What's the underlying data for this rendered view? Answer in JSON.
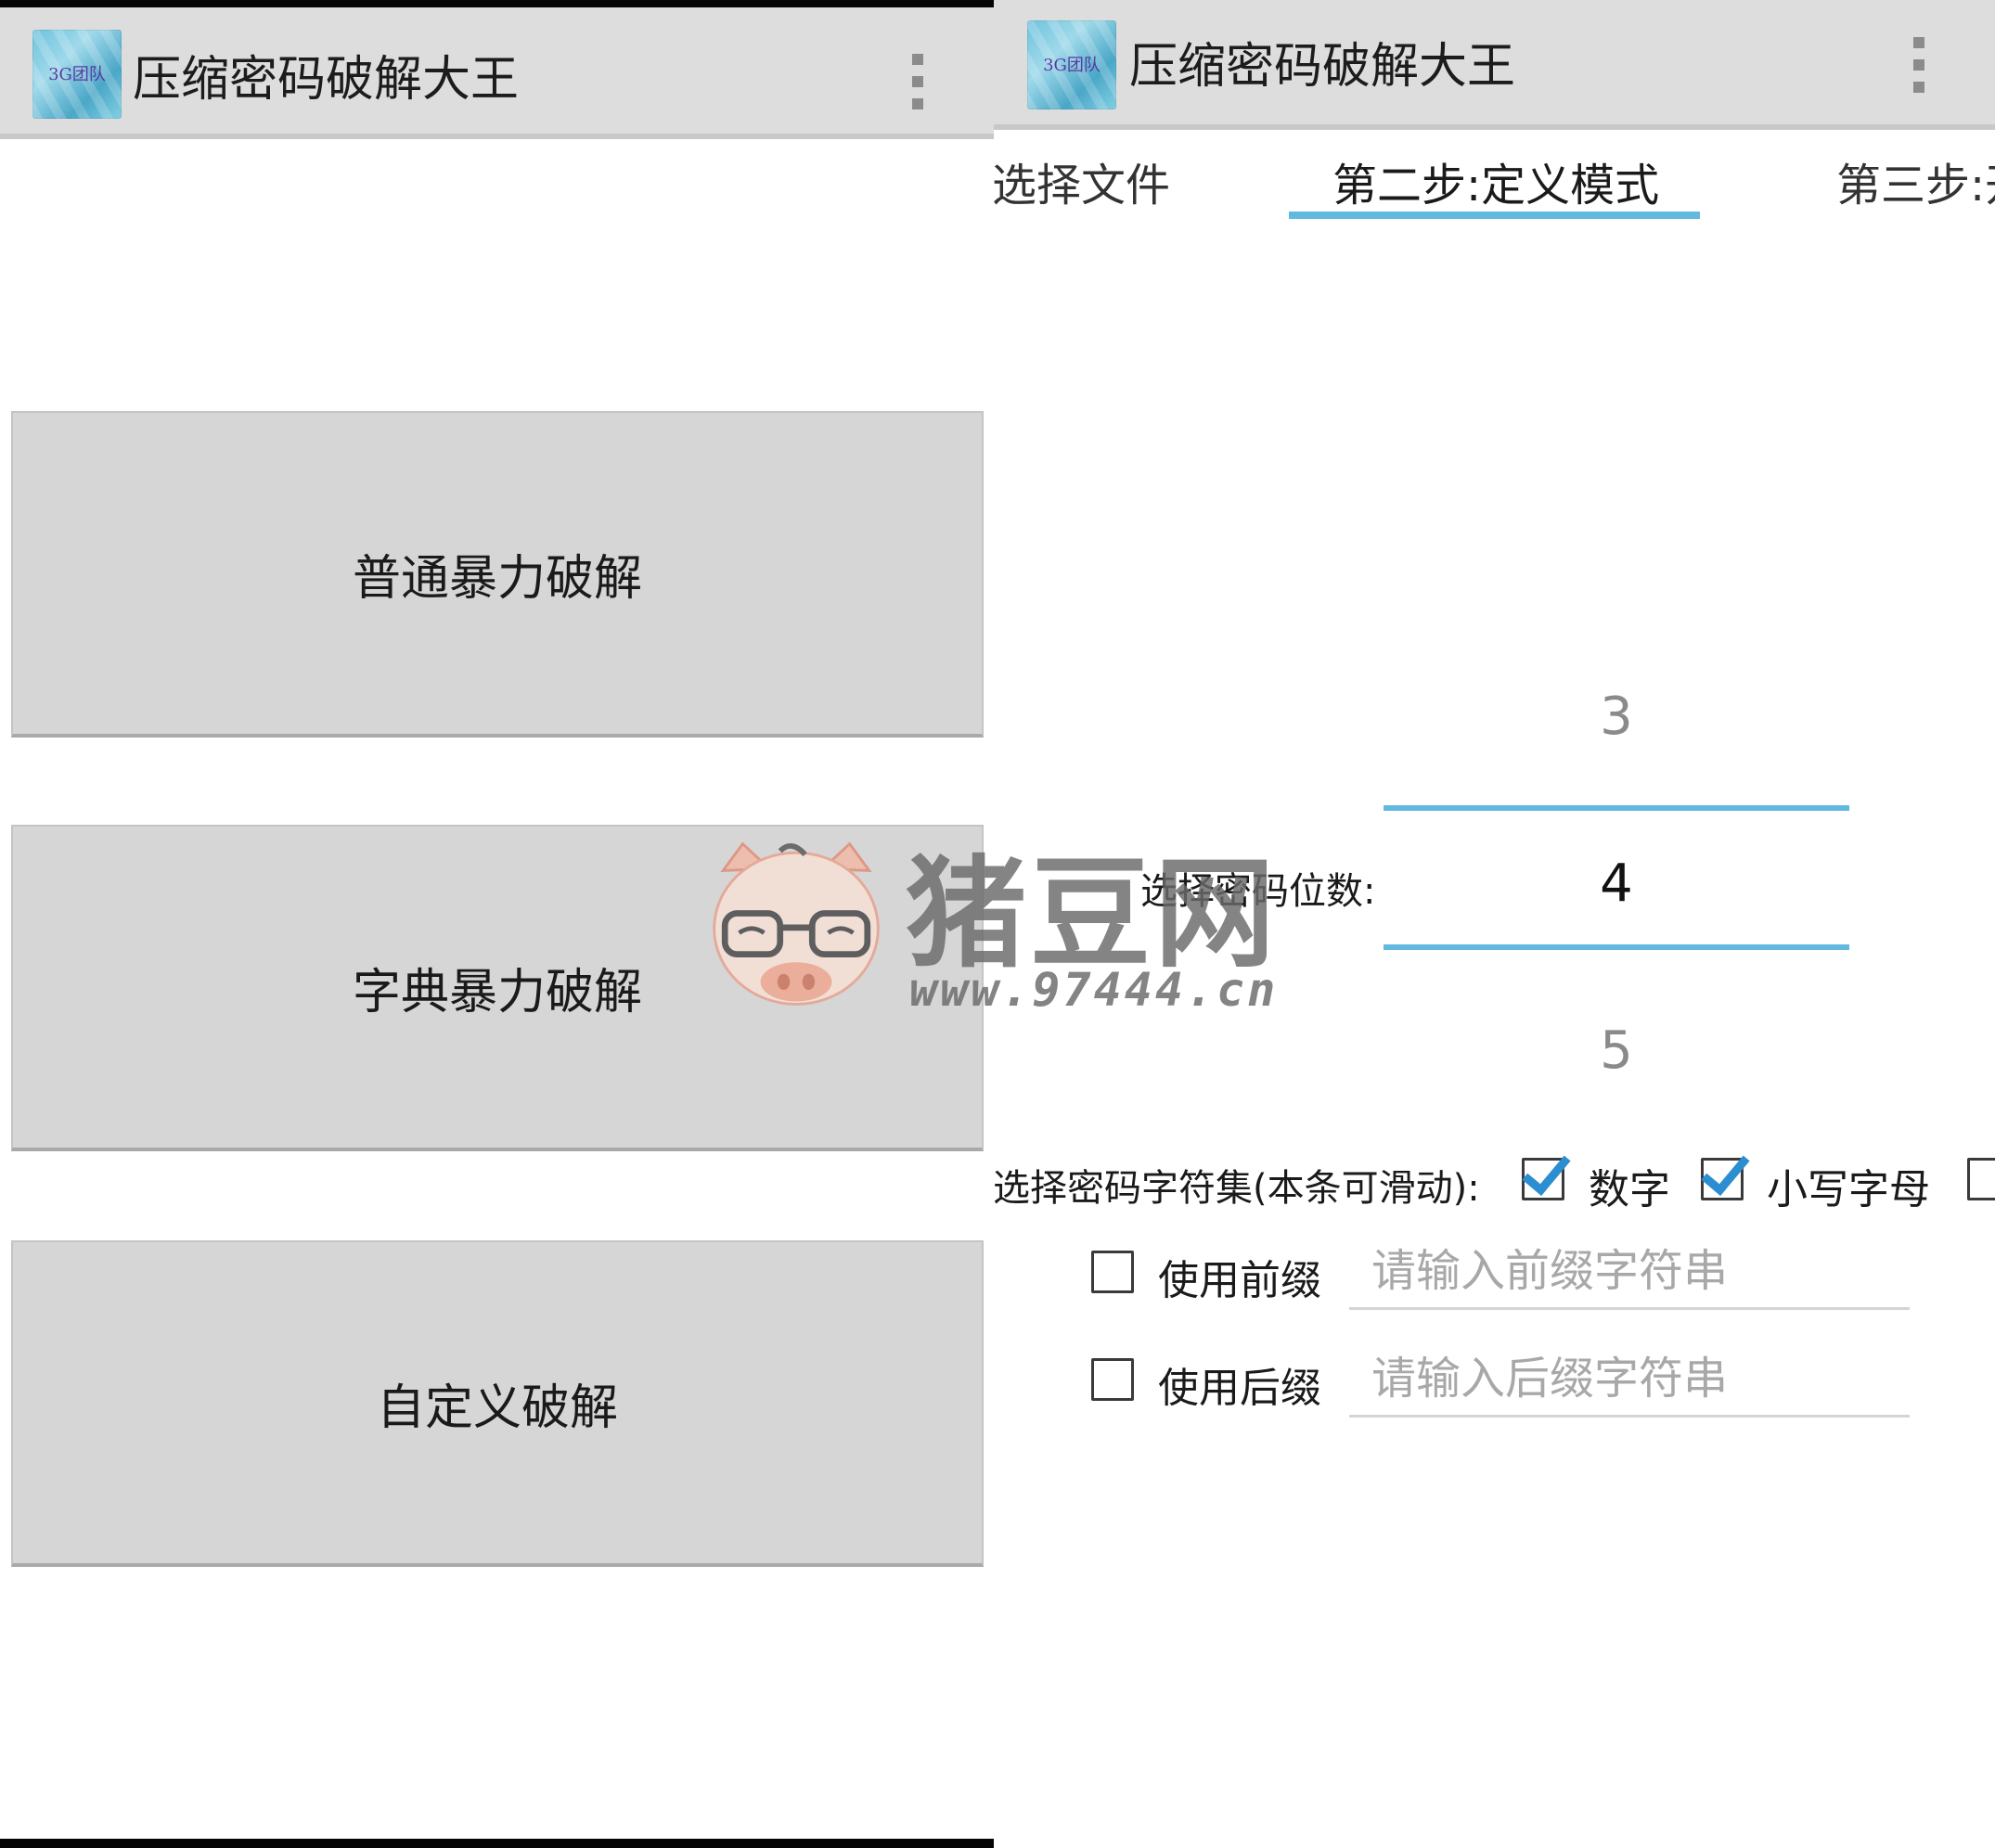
{
  "left": {
    "app_title": "压缩密码破解大王",
    "app_icon_text": "3G团队",
    "buttons": {
      "normal": "普通暴力破解",
      "dictionary": "字典暴力破解",
      "custom": "自定义破解"
    }
  },
  "right": {
    "app_title": "压缩密码破解大王",
    "app_icon_text": "3G团队",
    "tabs": {
      "step1": "选择文件",
      "step2": "第二步:定义模式",
      "step3": "第三步:开"
    },
    "password_length": {
      "label": "选择密码位数:",
      "prev": "3",
      "current": "4",
      "next": "5"
    },
    "charset": {
      "label": "选择密码字符集(本条可滑动):",
      "digits": "数字",
      "lowercase": "小写字母",
      "digits_checked": true,
      "lowercase_checked": true,
      "uppercase_checked": false
    },
    "prefix": {
      "label": "使用前缀",
      "placeholder": "请输入前缀字符串",
      "checked": false
    },
    "suffix": {
      "label": "使用后缀",
      "placeholder": "请输入后缀字符串",
      "checked": false
    }
  },
  "watermark": {
    "brand": "猪豆网",
    "url": "www.97444.cn"
  },
  "colors": {
    "accent": "#62b9df",
    "actionbar": "#dddddd",
    "button": "#d6d6d6",
    "checkmark": "#2a8ed0"
  }
}
